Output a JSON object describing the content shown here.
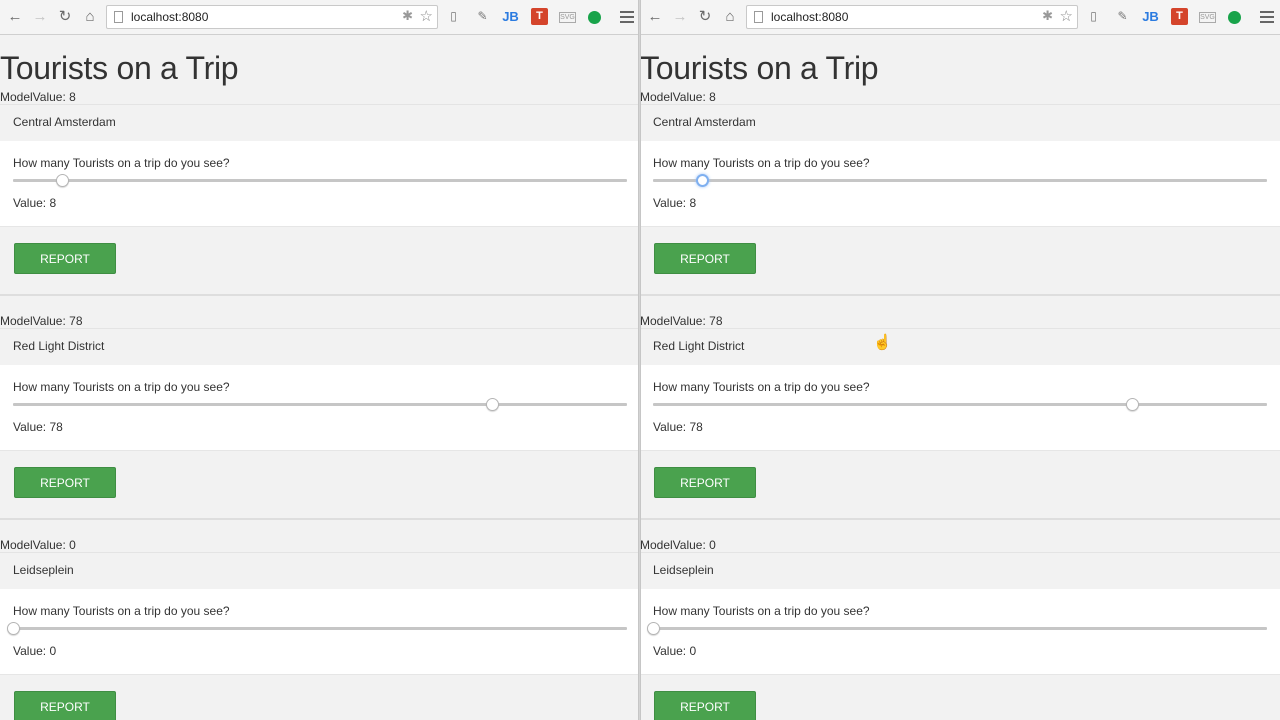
{
  "url": "localhost:8080",
  "title": "Tourists on a Trip",
  "model_value_prefix": "ModelValue: ",
  "question": "How many Tourists on a trip do you see?",
  "value_prefix": "Value: ",
  "report_label": "REPORT",
  "slider_range": [
    0,
    100
  ],
  "colors": {
    "report_button": "#4aa24e",
    "focus_ring": "#7fb0f0"
  },
  "extensions": [
    "reader-icon",
    "eyedropper-icon",
    "jb-icon",
    "t-icon",
    "svg-icon",
    "evernote-icon"
  ],
  "locations": [
    {
      "name": "Central Amsterdam",
      "model_value": "ModelValue: 8",
      "value_text": "Value: 8",
      "value": 8
    },
    {
      "name": "Red Light District",
      "model_value": "ModelValue: 78",
      "value_text": "Value: 78",
      "value": 78
    },
    {
      "name": "Leidseplein",
      "model_value": "ModelValue: 0",
      "value_text": "Value: 0",
      "value": 0
    }
  ],
  "windows": [
    {
      "id": "left",
      "focused_slider": -1
    },
    {
      "id": "right",
      "focused_slider": 0
    }
  ]
}
